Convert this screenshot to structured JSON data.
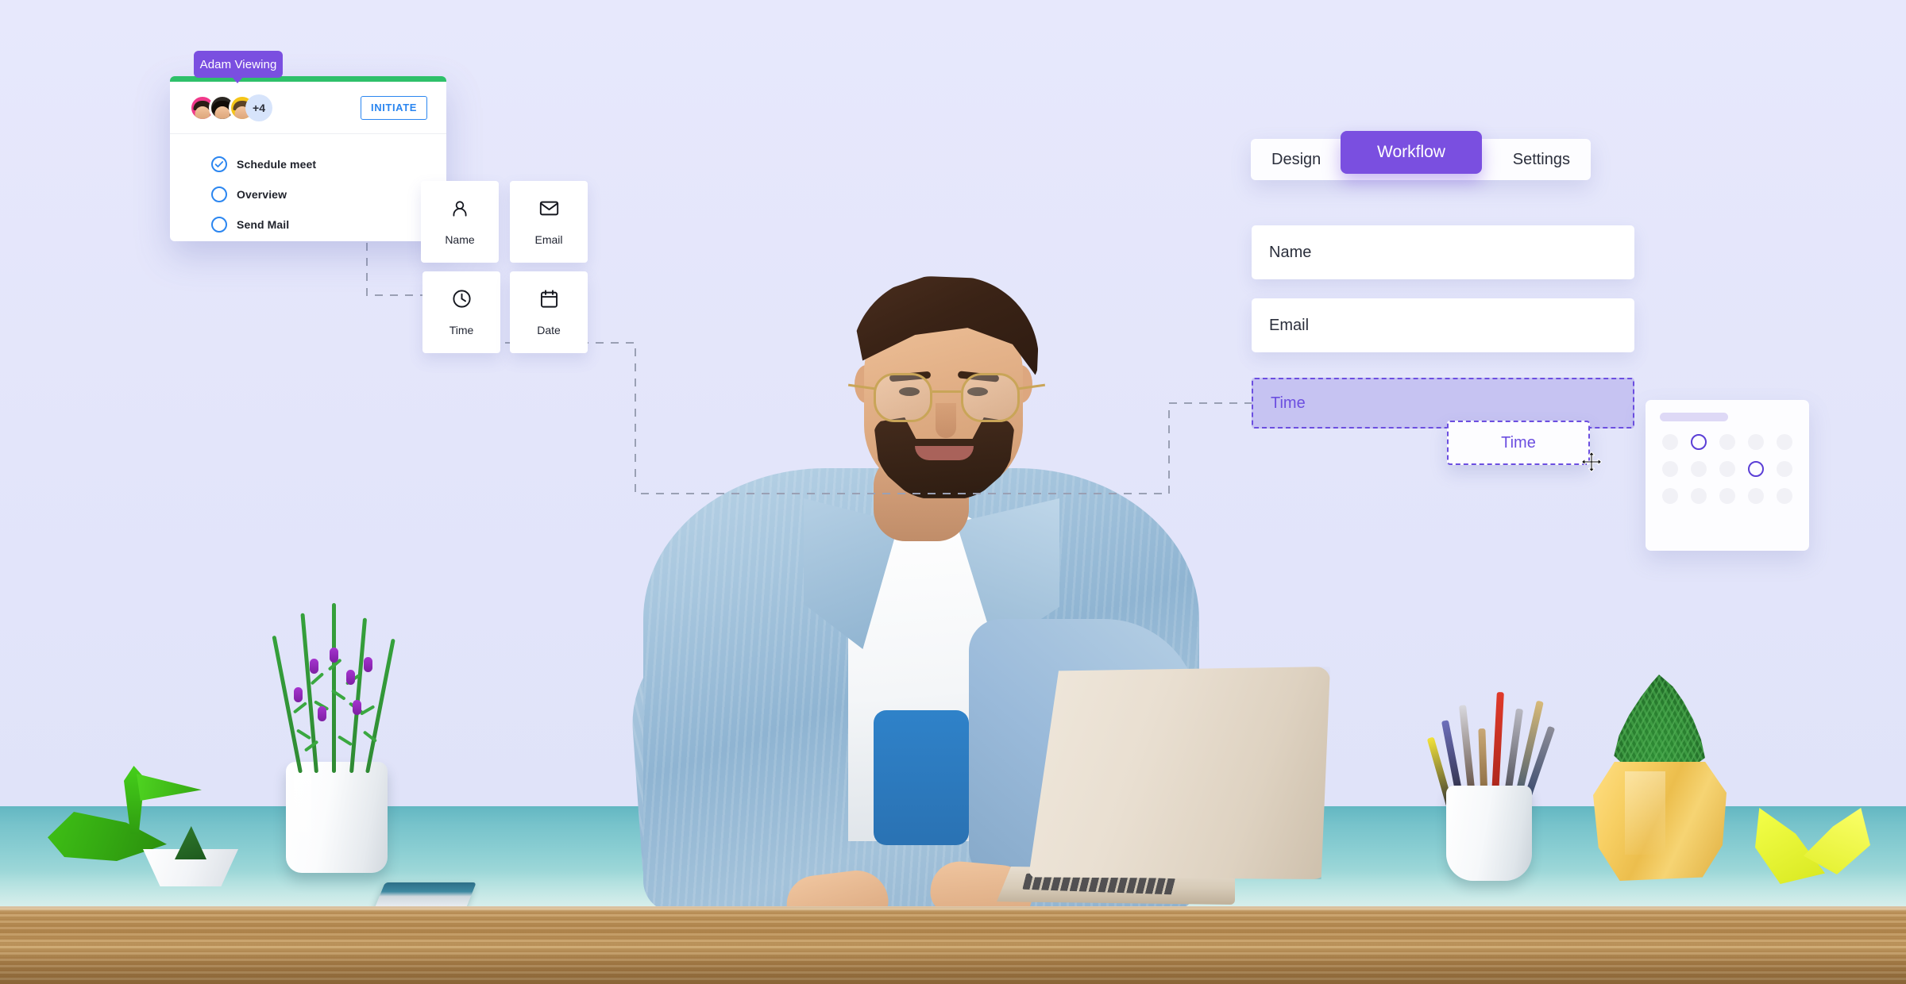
{
  "scene": {
    "background_color": "#e5e7fb",
    "desk_color": "#8ccfd3",
    "desk_edge_color": "#b98d52",
    "subject": "man-working-on-laptop",
    "objects": [
      "lavender-plant-white-pot",
      "green-origami-crane",
      "white-paper-boat",
      "smartphone",
      "cream-laptop",
      "pen-cup-with-pencils-and-brushes",
      "green-plant-yellow-faceted-pot",
      "yellow-origami-crane"
    ]
  },
  "task_card": {
    "viewing_badge": "Adam Viewing",
    "accent_top_color": "#2ec06a",
    "badge_color": "#7a4fe0",
    "avatar_overflow": "+4",
    "avatars": [
      {
        "ring_color": "#f0398a"
      },
      {
        "ring_color": "#2b2722"
      },
      {
        "ring_color": "#f5c518"
      }
    ],
    "initiate_label": "INITIATE",
    "initiate_color": "#2b86f0",
    "items": [
      {
        "label": "Schedule meet",
        "checked": true
      },
      {
        "label": "Overview",
        "checked": false
      },
      {
        "label": "Send Mail",
        "checked": false
      }
    ]
  },
  "field_tiles": [
    {
      "label": "Name",
      "icon": "person-icon"
    },
    {
      "label": "Email",
      "icon": "envelope-icon"
    },
    {
      "label": "Time",
      "icon": "clock-icon"
    },
    {
      "label": "Date",
      "icon": "calendar-icon"
    }
  ],
  "tabs": {
    "items": [
      {
        "label": "Design",
        "active": false
      },
      {
        "label": "Workflow",
        "active": true
      },
      {
        "label": "Settings",
        "active": false
      }
    ],
    "active_color": "#7a4fe0"
  },
  "form": {
    "fields": [
      {
        "label": "Name",
        "value": "",
        "placeholder": "Name"
      },
      {
        "label": "Email",
        "value": "",
        "placeholder": "Email"
      }
    ],
    "dropzone": {
      "label": "Time",
      "border_color": "#6c4fe0",
      "fill_color": "#c6c3f2"
    },
    "drag_chip": {
      "label": "Time",
      "cursor": "move-cursor"
    }
  },
  "calendar": {
    "header_pill_color": "#ded9f6",
    "dot_rows": 3,
    "dot_cols": 5,
    "selected_cells": [
      1,
      8
    ]
  }
}
